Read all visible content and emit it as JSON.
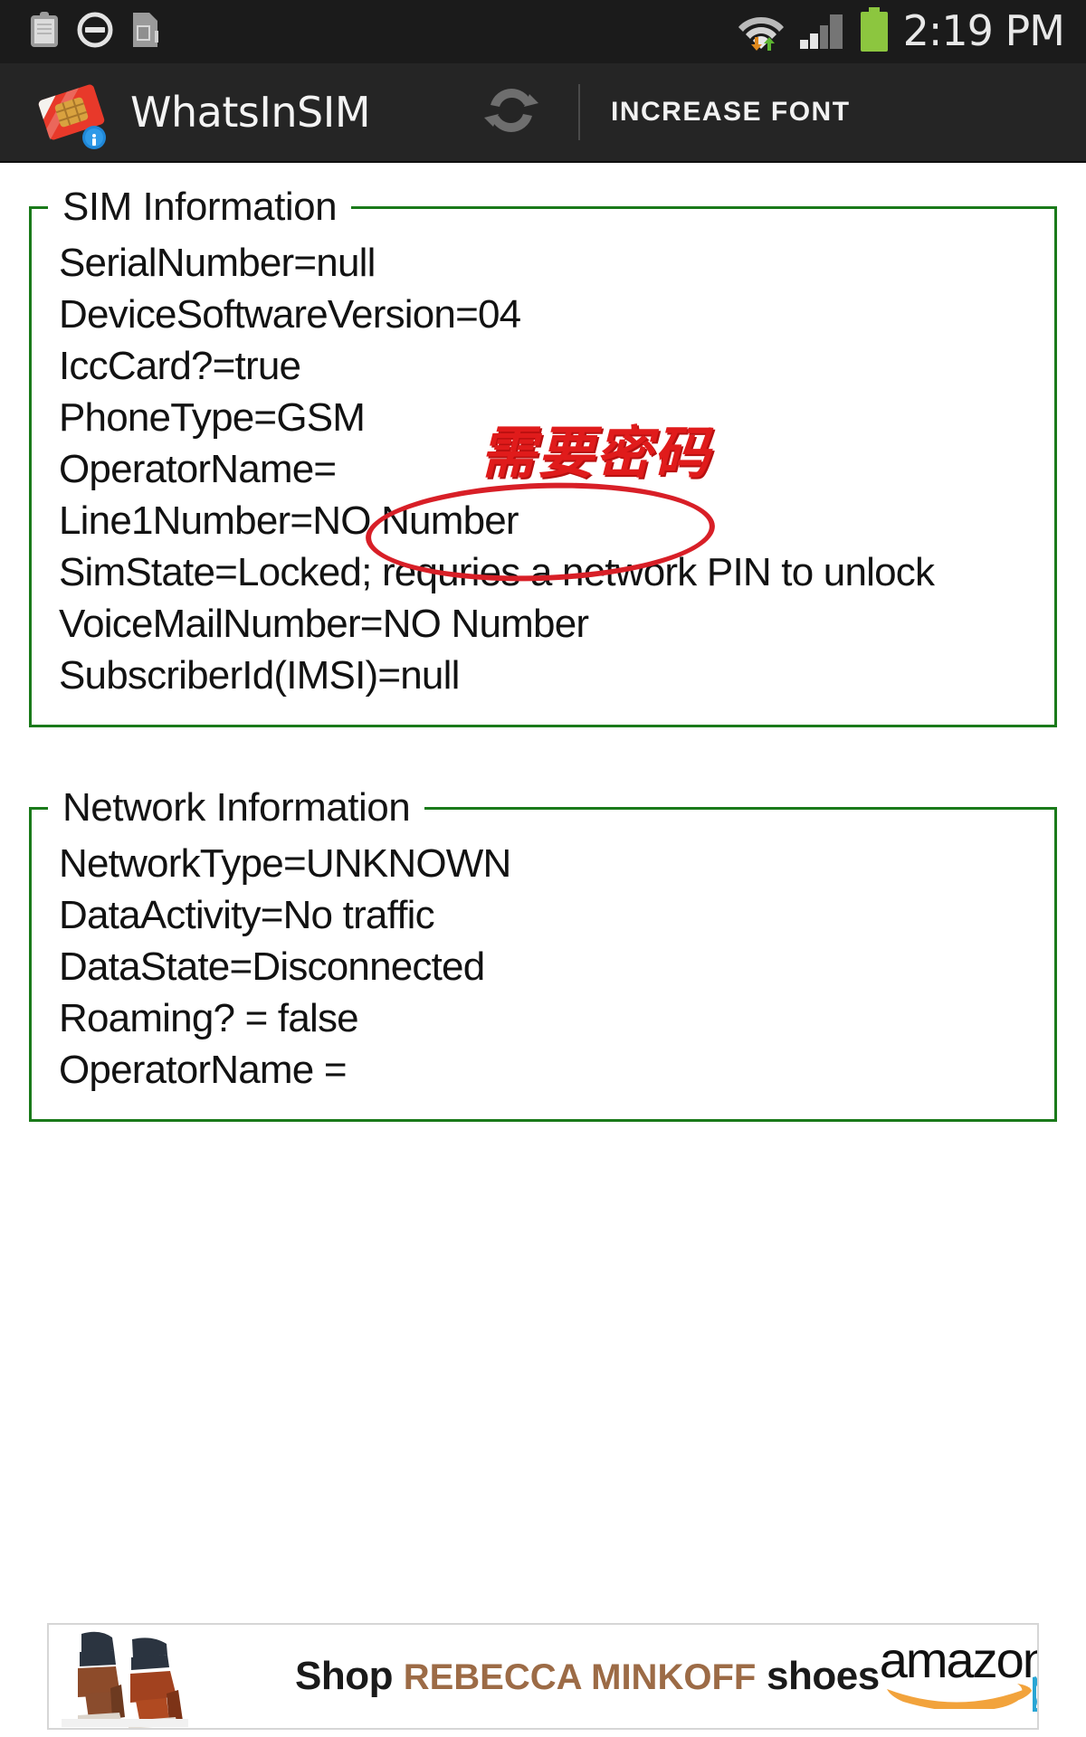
{
  "status_bar": {
    "time": "2:19 PM",
    "left_icons": [
      "clipboard-icon",
      "do-not-disturb-icon",
      "sim-card-icon"
    ],
    "right_icons": [
      "wifi-icon",
      "cellular-signal-icon",
      "battery-icon"
    ],
    "battery_color": "#8cc63f",
    "background": "#1b1b1b"
  },
  "action_bar": {
    "app_icon": "sim-card-info-icon",
    "title": "WhatsInSIM",
    "refresh_icon": "refresh-icon",
    "increase_font_label": "INCREASE FONT",
    "background": "#252525"
  },
  "sim_information": {
    "legend": "SIM Information",
    "border_color": "#1a7a1a",
    "lines": [
      "SerialNumber=null",
      "DeviceSoftwareVersion=04",
      "IccCard?=true",
      "PhoneType=GSM",
      "OperatorName=",
      "Line1Number=NO Number",
      "SimState=Locked; requries a network PIN to unlock",
      "VoiceMailNumber=NO Number",
      "SubscriberId(IMSI)=null"
    ]
  },
  "network_information": {
    "legend": "Network Information",
    "border_color": "#1a7a1a",
    "lines": [
      "NetworkType=UNKNOWN",
      "DataActivity=No traffic",
      "DataState=Disconnected",
      "Roaming? = false",
      "OperatorName ="
    ]
  },
  "annotation": {
    "text": "需要密码",
    "color": "#e01b1b",
    "ellipse_color": "#d81f27"
  },
  "ad": {
    "headline_prefix": "Shop ",
    "brand": "REBECCA MINKOFF",
    "headline_suffix": " shoes",
    "advertiser": "amazon",
    "adchoices_icon": "adchoices-icon",
    "product_image": "high-heel-shoes-image"
  }
}
